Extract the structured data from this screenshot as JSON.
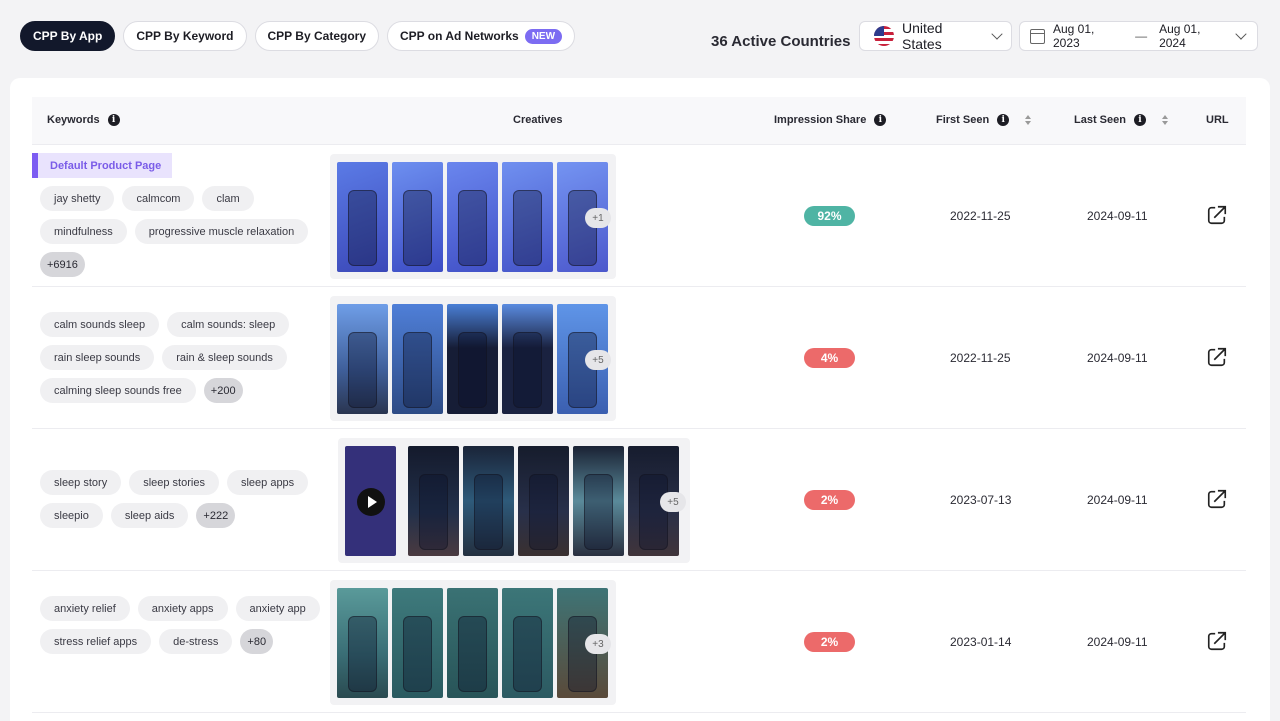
{
  "tabs": [
    {
      "label": "CPP By App",
      "active": true
    },
    {
      "label": "CPP By Keyword",
      "active": false
    },
    {
      "label": "CPP By Category",
      "active": false
    },
    {
      "label": "CPP on Ad Networks",
      "active": false,
      "badge": "NEW"
    }
  ],
  "filters": {
    "active_countries": "36 Active Countries",
    "country": "United States",
    "country_icon": "us-flag-icon",
    "date_start": "Aug 01, 2023",
    "date_separator": "—",
    "date_end": "Aug 01, 2024"
  },
  "table": {
    "columns": {
      "keywords": "Keywords",
      "creatives": "Creatives",
      "impression_share": "Impression Share",
      "first_seen": "First Seen",
      "last_seen": "Last Seen",
      "url": "URL"
    },
    "rows": [
      {
        "tag": "Default Product Page",
        "keywords": [
          "jay shetty",
          "calmcom",
          "clam",
          "mindfulness",
          "progressive muscle relaxation"
        ],
        "more_keywords": "+6916",
        "more_creatives": "+1",
        "impression_share": "92%",
        "share_color": "#4fb4a4",
        "first_seen": "2022-11-25",
        "last_seen": "2024-09-11"
      },
      {
        "keywords": [
          "calm sounds sleep",
          "calm sounds: sleep",
          "rain sleep sounds",
          "rain & sleep sounds",
          "calming sleep sounds free"
        ],
        "more_keywords": "+200",
        "more_creatives": "+5",
        "impression_share": "4%",
        "share_color": "#ec6a6a",
        "first_seen": "2022-11-25",
        "last_seen": "2024-09-11"
      },
      {
        "keywords": [
          "sleep story",
          "sleep stories",
          "sleep apps",
          "sleepio",
          "sleep aids"
        ],
        "more_keywords": "+222",
        "more_creatives": "+5",
        "impression_share": "2%",
        "share_color": "#ec6a6a",
        "first_seen": "2023-07-13",
        "last_seen": "2024-09-11"
      },
      {
        "keywords": [
          "anxiety relief",
          "anxiety apps",
          "anxiety app",
          "stress relief apps",
          "de-stress"
        ],
        "more_keywords": "+80",
        "more_creatives": "+3",
        "impression_share": "2%",
        "share_color": "#ec6a6a",
        "first_seen": "2023-01-14",
        "last_seen": "2024-09-11"
      }
    ]
  }
}
